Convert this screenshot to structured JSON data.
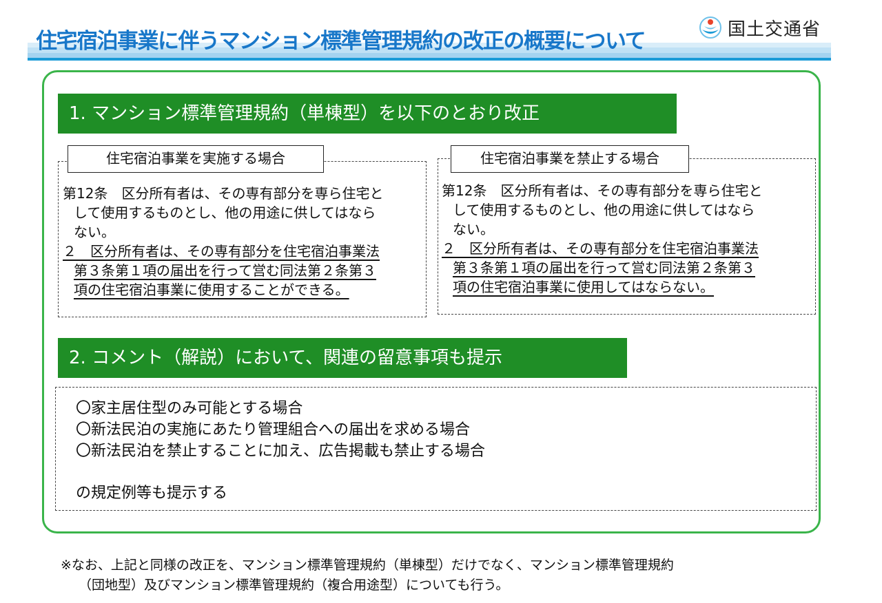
{
  "header": {
    "title": "住宅宿泊事業に伴うマンション標準管理規約の改正の概要について",
    "logo_text": "国土交通省",
    "logo_icon": "mlit-logo-icon"
  },
  "section1": {
    "heading": "1. マンション標準管理規約（単棟型）を以下のとおり改正",
    "left": {
      "label": "住宅宿泊事業を実施する場合",
      "lines": [
        "第12条　区分所有者は、その専有部分を専ら住宅と",
        "して使用するものとし、他の用途に供してはなら",
        "ない。"
      ],
      "underlined_lines": [
        "２　区分所有者は、その専有部分を住宅宿泊事業法",
        "第３条第１項の届出を行って営む同法第２条第３",
        "項の住宅宿泊事業に使用することができる。"
      ]
    },
    "right": {
      "label": "住宅宿泊事業を禁止する場合",
      "lines": [
        "第12条　区分所有者は、その専有部分を専ら住宅と",
        "して使用するものとし、他の用途に供してはなら",
        "ない。"
      ],
      "underlined_lines": [
        "２　区分所有者は、その専有部分を住宅宿泊事業法",
        "第３条第１項の届出を行って営む同法第２条第３",
        "項の住宅宿泊事業に使用してはならない。"
      ]
    }
  },
  "section2": {
    "heading": "2. コメント（解説）において、関連の留意事項も提示",
    "items": [
      "〇家主居住型のみ可能とする場合",
      "〇新法民泊の実施にあたり管理組合への届出を求める場合",
      "〇新法民泊を禁止することに加え、広告掲載も禁止する場合"
    ],
    "closing": "の規定例等も提示する"
  },
  "footnote": {
    "line1": "※なお、上記と同様の改正を、マンション標準管理規約（単棟型）だけでなく、マンション標準管理規約",
    "line2": "（団地型）及びマンション標準管理規約（複合用途型）についても行う。"
  },
  "colors": {
    "title": "#1877c9",
    "green_bar": "#1f8e26",
    "frame": "#3ab44a",
    "stripe": "#1a9bd7"
  }
}
